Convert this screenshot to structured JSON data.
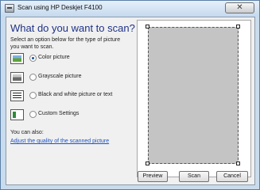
{
  "window": {
    "title": "Scan using HP Deskjet F4100",
    "close_glyph": "✕"
  },
  "heading": "What do you want to scan?",
  "instruction": "Select an option below for the type of picture you want to scan.",
  "options": [
    {
      "label": "Color picture",
      "icon": "color-picture-icon",
      "selected": true
    },
    {
      "label": "Grayscale picture",
      "icon": "grayscale-picture-icon",
      "selected": false
    },
    {
      "label": "Black and white picture or text",
      "icon": "black-white-text-icon",
      "selected": false
    },
    {
      "label": "Custom Settings",
      "icon": "custom-settings-icon",
      "selected": false
    }
  ],
  "also_label": "You can also:",
  "adjust_link": "Adjust the quality of the scanned picture",
  "buttons": {
    "preview": "Preview",
    "scan": "Scan",
    "cancel": "Cancel"
  }
}
